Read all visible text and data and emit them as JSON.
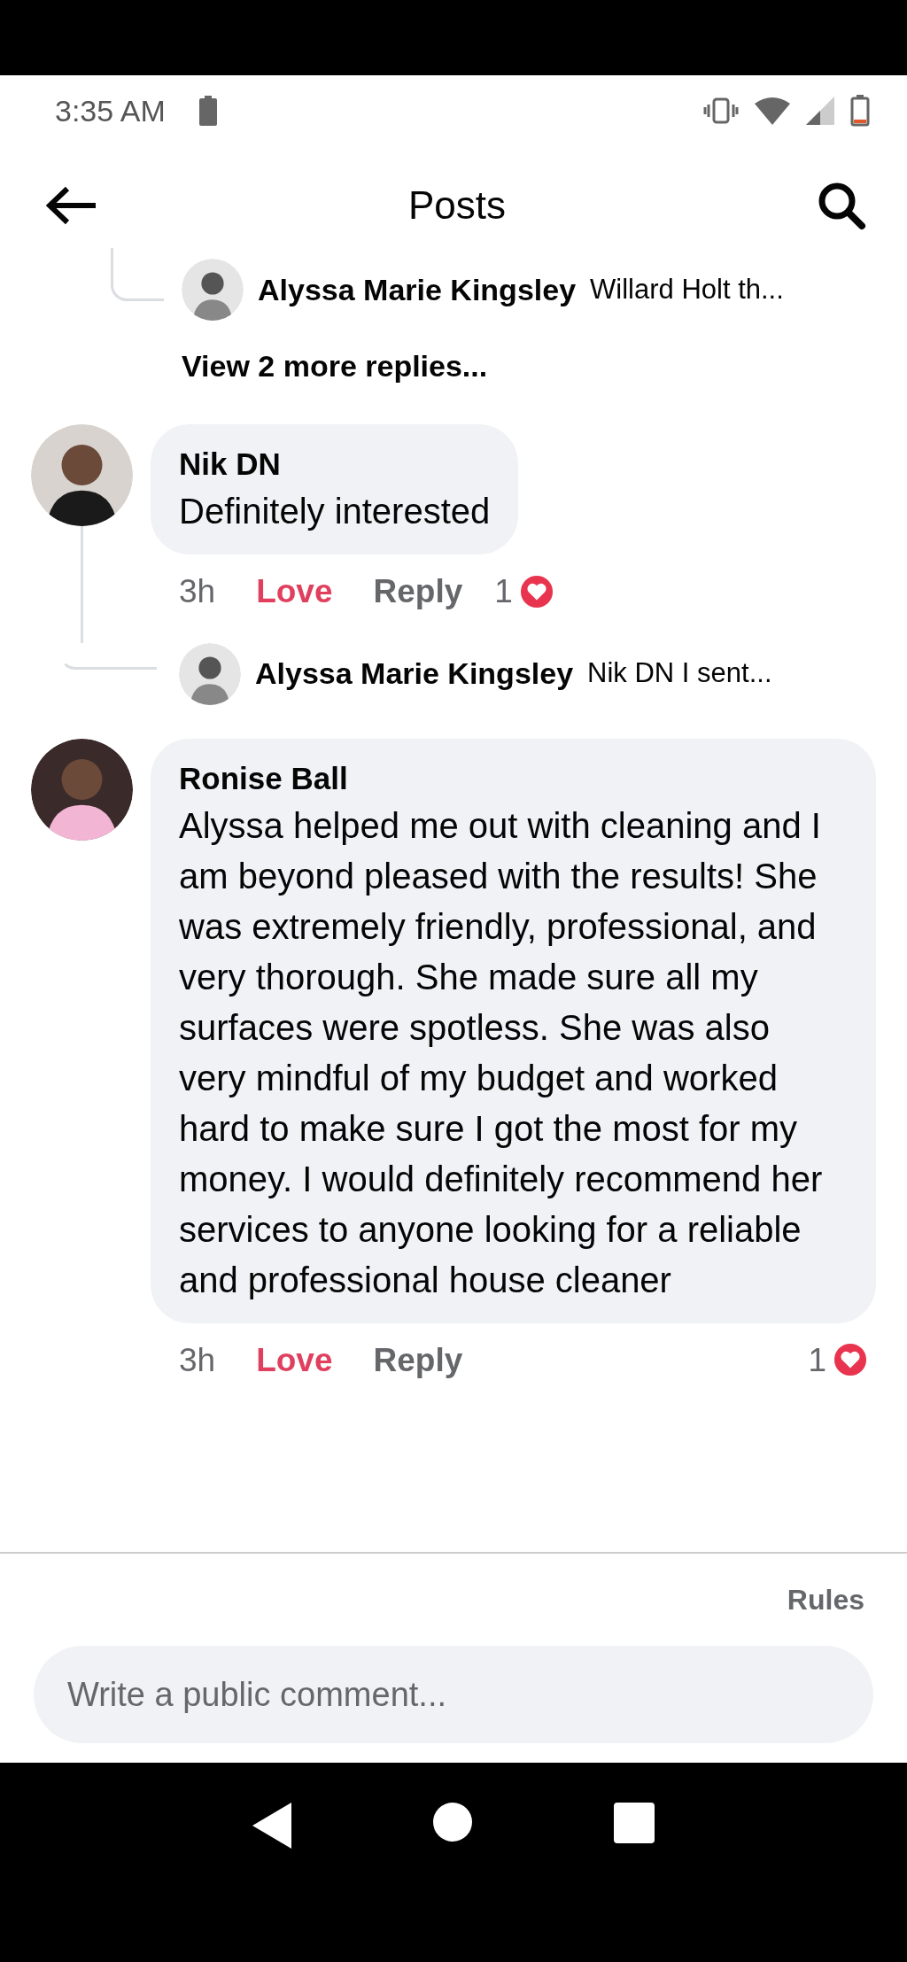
{
  "status_bar": {
    "time": "3:35 AM"
  },
  "header": {
    "title": "Posts"
  },
  "top_reply": {
    "author": "Alyssa Marie Kingsley",
    "text": "Willard Holt th..."
  },
  "view_more": "View 2 more replies...",
  "comments": [
    {
      "author": "Nik DN",
      "text": "Definitely interested",
      "time": "3h",
      "love": "Love",
      "reacted": true,
      "reply": "Reply",
      "reaction_count": "1",
      "replies": [
        {
          "author": "Alyssa Marie Kingsley",
          "text": "Nik DN I sent..."
        }
      ]
    },
    {
      "author": "Ronise Ball",
      "text": "Alyssa helped me out with cleaning and I am beyond pleased with the results! She was extremely friendly, professional, and very thorough. She made sure all my surfaces were spotless. She was also very mindful of my budget and worked hard to make sure I got the most for my money. I would definitely recommend her services to anyone looking for a reliable and professional house cleaner",
      "time": "3h",
      "love": "Love",
      "reacted": true,
      "reply": "Reply",
      "reaction_count": "1"
    }
  ],
  "rules": "Rules",
  "composer": {
    "placeholder": "Write a public comment..."
  }
}
